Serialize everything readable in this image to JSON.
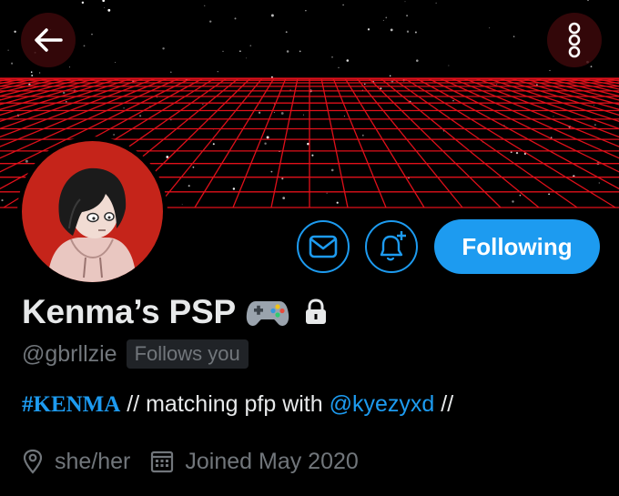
{
  "profile": {
    "display_name": "Kenma’s PSP",
    "handle": "@gbrllzie",
    "follows_you": "Follows you",
    "bio": {
      "hashtag": "#KENMA",
      "text_1": " // matching pfp with ",
      "mention": "@kyezyxd",
      "text_2": " //"
    },
    "pronouns": "she/her",
    "joined": "Joined May 2020"
  },
  "actions": {
    "follow_label": "Following"
  },
  "icons": {
    "back": "arrow-left-icon",
    "more": "more-vertical-icon",
    "message": "envelope-icon",
    "notifications": "bell-plus-icon",
    "badge_emoji": "game-controller-icon",
    "protected": "lock-icon",
    "location": "location-pin-icon",
    "calendar": "calendar-icon"
  },
  "colors": {
    "accent": "#1d9bf0",
    "banner_grid": "#e0101a",
    "avatar_bg": "#c5241a",
    "muted_text": "#71767b"
  }
}
